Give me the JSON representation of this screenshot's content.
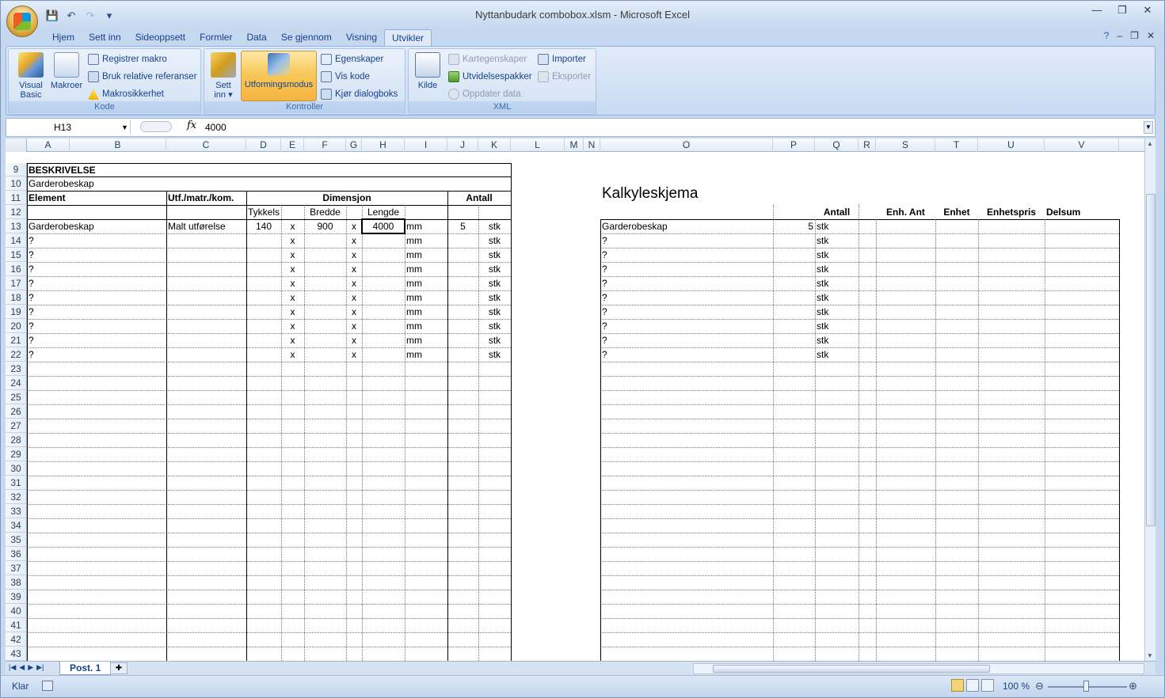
{
  "window": {
    "title": "Nyttanbudark combobox.xlsm - Microsoft Excel",
    "minimize": "—",
    "restore": "❐",
    "close": "✕"
  },
  "qat": {
    "save_icon": "save-icon",
    "undo_icon": "undo-icon",
    "redo_icon": "redo-icon",
    "customize": "▾"
  },
  "tabs": [
    "Hjem",
    "Sett inn",
    "Sideoppsett",
    "Formler",
    "Data",
    "Se gjennom",
    "Visning",
    "Utvikler"
  ],
  "active_tab": "Utvikler",
  "ribbon": {
    "kode": {
      "label": "Kode",
      "visual_basic": "Visual Basic",
      "visual_basic_l1": "Visual",
      "visual_basic_l2": "Basic",
      "makroer": "Makroer",
      "registrer": "Registrer makro",
      "relative": "Bruk relative referanser",
      "sikkerhet": "Makrosikkerhet"
    },
    "kontroller": {
      "label": "Kontroller",
      "sett_inn_l1": "Sett",
      "sett_inn_l2": "inn ▾",
      "utforming": "Utformingsmodus",
      "egenskaper": "Egenskaper",
      "vis_kode": "Vis kode",
      "kjor": "Kjør dialogboks"
    },
    "xml": {
      "label": "XML",
      "kilde": "Kilde",
      "kart": "Kartegenskaper",
      "utvidelse": "Utvidelsespakker",
      "oppdater": "Oppdater data",
      "importer": "Importer",
      "eksporter": "Eksporter"
    }
  },
  "formula_bar": {
    "name_box": "H13",
    "fx": "fx",
    "value": "4000"
  },
  "columns": [
    "A",
    "B",
    "C",
    "D",
    "E",
    "F",
    "G",
    "H",
    "I",
    "J",
    "K",
    "L",
    "M",
    "N",
    "O",
    "P",
    "Q",
    "R",
    "S",
    "T",
    "U",
    "V"
  ],
  "rows": [
    "9",
    "10",
    "11",
    "12",
    "13",
    "14",
    "15",
    "16",
    "17",
    "18",
    "19",
    "20",
    "21",
    "22",
    "23",
    "24",
    "25",
    "26",
    "27",
    "28",
    "29",
    "30",
    "31",
    "32",
    "33",
    "34",
    "35",
    "36",
    "37",
    "38",
    "39",
    "40",
    "41",
    "42",
    "43"
  ],
  "sheet": {
    "beskrivelse": "BESKRIVELSE",
    "garderobeskap_title": "Garderobeskap",
    "hdr_element": "Element",
    "hdr_utf": "Utf./matr./kom.",
    "hdr_dimensjon": "Dimensjon",
    "hdr_antall": "Antall",
    "hdr_tykkelse": "Tykkelse",
    "hdr_bredde": "Bredde",
    "hdr_lengde": "Lengde",
    "row13": {
      "element": "Garderobeskap",
      "utf": "Malt utførelse",
      "tykkelse": "140",
      "x1": "x",
      "bredde": "900",
      "x2": "x",
      "lengde": "4000",
      "unit": "mm",
      "antall": "5",
      "enh": "stk"
    },
    "placeholder_rows": [
      {
        "element": "?",
        "x1": "x",
        "x2": "x",
        "unit": "mm",
        "enh": "stk"
      },
      {
        "element": "?",
        "x1": "x",
        "x2": "x",
        "unit": "mm",
        "enh": "stk"
      },
      {
        "element": "?",
        "x1": "x",
        "x2": "x",
        "unit": "mm",
        "enh": "stk"
      },
      {
        "element": "?",
        "x1": "x",
        "x2": "x",
        "unit": "mm",
        "enh": "stk"
      },
      {
        "element": "?",
        "x1": "x",
        "x2": "x",
        "unit": "mm",
        "enh": "stk"
      },
      {
        "element": "?",
        "x1": "x",
        "x2": "x",
        "unit": "mm",
        "enh": "stk"
      },
      {
        "element": "?",
        "x1": "x",
        "x2": "x",
        "unit": "mm",
        "enh": "stk"
      },
      {
        "element": "?",
        "x1": "x",
        "x2": "x",
        "unit": "mm",
        "enh": "stk"
      },
      {
        "element": "?",
        "x1": "x",
        "x2": "x",
        "unit": "mm",
        "enh": "stk"
      }
    ],
    "kalkyle_title": "Kalkyleskjema",
    "k_hdr_antall": "Antall",
    "k_hdr_enh_ant": "Enh. Ant",
    "k_hdr_enhet": "Enhet",
    "k_hdr_enhetspris": "Enhetspris",
    "k_hdr_delsum": "Delsum",
    "k_row13": {
      "element": "Garderobeskap",
      "antall": "5",
      "enh": "stk"
    },
    "k_placeholder_rows": [
      {
        "element": "?",
        "enh": "stk"
      },
      {
        "element": "?",
        "enh": "stk"
      },
      {
        "element": "?",
        "enh": "stk"
      },
      {
        "element": "?",
        "enh": "stk"
      },
      {
        "element": "?",
        "enh": "stk"
      },
      {
        "element": "?",
        "enh": "stk"
      },
      {
        "element": "?",
        "enh": "stk"
      },
      {
        "element": "?",
        "enh": "stk"
      },
      {
        "element": "?",
        "enh": "stk"
      }
    ]
  },
  "sheet_tabs": {
    "active": "Post. 1"
  },
  "status": {
    "ready": "Klar",
    "zoom": "100 %"
  }
}
